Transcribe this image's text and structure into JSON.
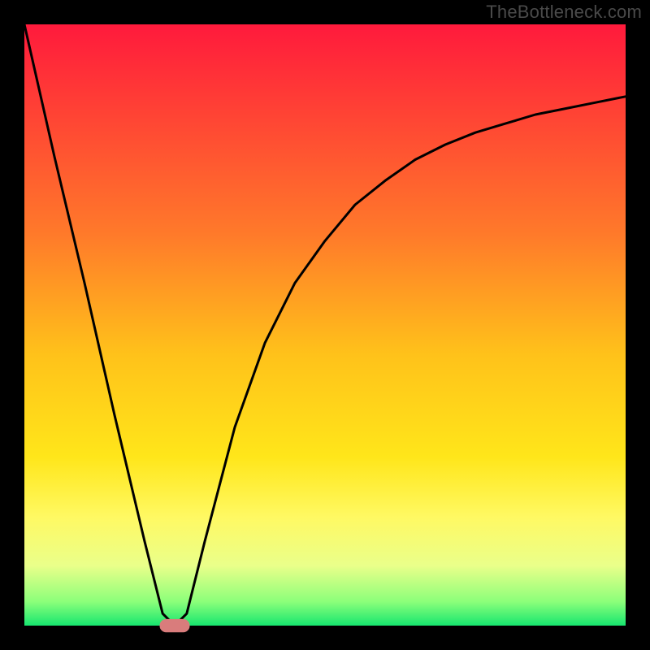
{
  "watermark": "TheBottleneck.com",
  "chart_data": {
    "type": "line",
    "title": "",
    "xlabel": "",
    "ylabel": "",
    "xlim": [
      0,
      100
    ],
    "ylim": [
      0,
      100
    ],
    "grid": false,
    "gradient_stops": [
      {
        "offset": 0,
        "color": "#ff1a3c"
      },
      {
        "offset": 35,
        "color": "#ff7a2a"
      },
      {
        "offset": 55,
        "color": "#ffc21a"
      },
      {
        "offset": 72,
        "color": "#ffe61a"
      },
      {
        "offset": 82,
        "color": "#fff963"
      },
      {
        "offset": 90,
        "color": "#eaff8a"
      },
      {
        "offset": 96,
        "color": "#8cff7a"
      },
      {
        "offset": 100,
        "color": "#17e66f"
      }
    ],
    "series": [
      {
        "name": "bottleneck-curve",
        "x": [
          0,
          5,
          10,
          15,
          20,
          23,
          25,
          27,
          30,
          35,
          40,
          45,
          50,
          55,
          60,
          65,
          70,
          75,
          80,
          85,
          90,
          95,
          100
        ],
        "values": [
          100,
          78,
          57,
          35,
          14,
          2,
          0,
          2,
          14,
          33,
          47,
          57,
          64,
          70,
          74,
          77.5,
          80,
          82,
          83.5,
          85,
          86,
          87,
          88
        ]
      }
    ],
    "marker": {
      "x": 25,
      "y": 0,
      "color": "#d97c7c",
      "width": 5,
      "height": 2.2
    },
    "legend": false
  }
}
